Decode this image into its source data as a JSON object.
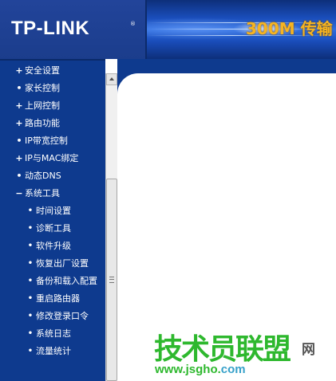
{
  "header": {
    "logo": "TP-LINK",
    "logo_mark": "®",
    "banner_text": "300M 传输"
  },
  "sidebar": {
    "items": [
      {
        "marker": "+",
        "label": "安全设置",
        "level": 0,
        "clipped": true
      },
      {
        "marker": "•",
        "label": "家长控制",
        "level": 0
      },
      {
        "marker": "+",
        "label": "上网控制",
        "level": 0
      },
      {
        "marker": "+",
        "label": "路由功能",
        "level": 0
      },
      {
        "marker": "•",
        "label": "IP带宽控制",
        "level": 0
      },
      {
        "marker": "+",
        "label": "IP与MAC绑定",
        "level": 0
      },
      {
        "marker": "•",
        "label": "动态DNS",
        "level": 0
      },
      {
        "marker": "−",
        "label": "系统工具",
        "level": 0
      },
      {
        "marker": "•",
        "label": "时间设置",
        "level": 1
      },
      {
        "marker": "•",
        "label": "诊断工具",
        "level": 1
      },
      {
        "marker": "•",
        "label": "软件升级",
        "level": 1
      },
      {
        "marker": "•",
        "label": "恢复出厂设置",
        "level": 1
      },
      {
        "marker": "•",
        "label": "备份和载入配置",
        "level": 1
      },
      {
        "marker": "•",
        "label": "重启路由器",
        "level": 1
      },
      {
        "marker": "•",
        "label": "修改登录口令",
        "level": 1
      },
      {
        "marker": "•",
        "label": "系统日志",
        "level": 1
      },
      {
        "marker": "•",
        "label": "流量统计",
        "level": 1
      }
    ]
  },
  "watermark": {
    "title": "技术员联盟",
    "net": "网",
    "url_main": "www.jsgho.",
    "url_tld": "com"
  },
  "colors": {
    "nav_bg": "#0e3a8e",
    "header_bg": "#1a3f8f",
    "banner_text": "#f6b422",
    "watermark_green": "#2eb82e"
  }
}
